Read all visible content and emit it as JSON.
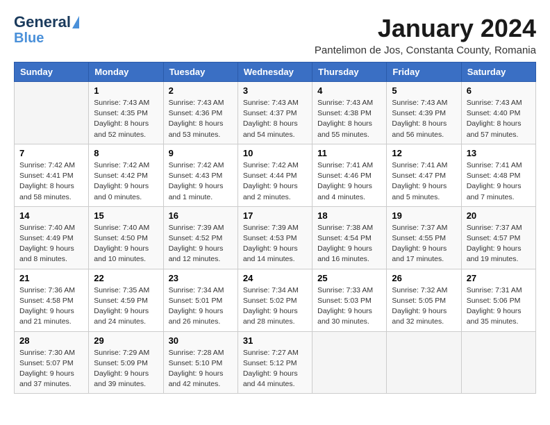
{
  "logo": {
    "line1": "General",
    "line2": "Blue"
  },
  "title": "January 2024",
  "location": "Pantelimon de Jos, Constanta County, Romania",
  "days_of_week": [
    "Sunday",
    "Monday",
    "Tuesday",
    "Wednesday",
    "Thursday",
    "Friday",
    "Saturday"
  ],
  "weeks": [
    [
      {
        "day": "",
        "info": ""
      },
      {
        "day": "1",
        "info": "Sunrise: 7:43 AM\nSunset: 4:35 PM\nDaylight: 8 hours\nand 52 minutes."
      },
      {
        "day": "2",
        "info": "Sunrise: 7:43 AM\nSunset: 4:36 PM\nDaylight: 8 hours\nand 53 minutes."
      },
      {
        "day": "3",
        "info": "Sunrise: 7:43 AM\nSunset: 4:37 PM\nDaylight: 8 hours\nand 54 minutes."
      },
      {
        "day": "4",
        "info": "Sunrise: 7:43 AM\nSunset: 4:38 PM\nDaylight: 8 hours\nand 55 minutes."
      },
      {
        "day": "5",
        "info": "Sunrise: 7:43 AM\nSunset: 4:39 PM\nDaylight: 8 hours\nand 56 minutes."
      },
      {
        "day": "6",
        "info": "Sunrise: 7:43 AM\nSunset: 4:40 PM\nDaylight: 8 hours\nand 57 minutes."
      }
    ],
    [
      {
        "day": "7",
        "info": "Sunrise: 7:42 AM\nSunset: 4:41 PM\nDaylight: 8 hours\nand 58 minutes."
      },
      {
        "day": "8",
        "info": "Sunrise: 7:42 AM\nSunset: 4:42 PM\nDaylight: 9 hours\nand 0 minutes."
      },
      {
        "day": "9",
        "info": "Sunrise: 7:42 AM\nSunset: 4:43 PM\nDaylight: 9 hours\nand 1 minute."
      },
      {
        "day": "10",
        "info": "Sunrise: 7:42 AM\nSunset: 4:44 PM\nDaylight: 9 hours\nand 2 minutes."
      },
      {
        "day": "11",
        "info": "Sunrise: 7:41 AM\nSunset: 4:46 PM\nDaylight: 9 hours\nand 4 minutes."
      },
      {
        "day": "12",
        "info": "Sunrise: 7:41 AM\nSunset: 4:47 PM\nDaylight: 9 hours\nand 5 minutes."
      },
      {
        "day": "13",
        "info": "Sunrise: 7:41 AM\nSunset: 4:48 PM\nDaylight: 9 hours\nand 7 minutes."
      }
    ],
    [
      {
        "day": "14",
        "info": "Sunrise: 7:40 AM\nSunset: 4:49 PM\nDaylight: 9 hours\nand 8 minutes."
      },
      {
        "day": "15",
        "info": "Sunrise: 7:40 AM\nSunset: 4:50 PM\nDaylight: 9 hours\nand 10 minutes."
      },
      {
        "day": "16",
        "info": "Sunrise: 7:39 AM\nSunset: 4:52 PM\nDaylight: 9 hours\nand 12 minutes."
      },
      {
        "day": "17",
        "info": "Sunrise: 7:39 AM\nSunset: 4:53 PM\nDaylight: 9 hours\nand 14 minutes."
      },
      {
        "day": "18",
        "info": "Sunrise: 7:38 AM\nSunset: 4:54 PM\nDaylight: 9 hours\nand 16 minutes."
      },
      {
        "day": "19",
        "info": "Sunrise: 7:37 AM\nSunset: 4:55 PM\nDaylight: 9 hours\nand 17 minutes."
      },
      {
        "day": "20",
        "info": "Sunrise: 7:37 AM\nSunset: 4:57 PM\nDaylight: 9 hours\nand 19 minutes."
      }
    ],
    [
      {
        "day": "21",
        "info": "Sunrise: 7:36 AM\nSunset: 4:58 PM\nDaylight: 9 hours\nand 21 minutes."
      },
      {
        "day": "22",
        "info": "Sunrise: 7:35 AM\nSunset: 4:59 PM\nDaylight: 9 hours\nand 24 minutes."
      },
      {
        "day": "23",
        "info": "Sunrise: 7:34 AM\nSunset: 5:01 PM\nDaylight: 9 hours\nand 26 minutes."
      },
      {
        "day": "24",
        "info": "Sunrise: 7:34 AM\nSunset: 5:02 PM\nDaylight: 9 hours\nand 28 minutes."
      },
      {
        "day": "25",
        "info": "Sunrise: 7:33 AM\nSunset: 5:03 PM\nDaylight: 9 hours\nand 30 minutes."
      },
      {
        "day": "26",
        "info": "Sunrise: 7:32 AM\nSunset: 5:05 PM\nDaylight: 9 hours\nand 32 minutes."
      },
      {
        "day": "27",
        "info": "Sunrise: 7:31 AM\nSunset: 5:06 PM\nDaylight: 9 hours\nand 35 minutes."
      }
    ],
    [
      {
        "day": "28",
        "info": "Sunrise: 7:30 AM\nSunset: 5:07 PM\nDaylight: 9 hours\nand 37 minutes."
      },
      {
        "day": "29",
        "info": "Sunrise: 7:29 AM\nSunset: 5:09 PM\nDaylight: 9 hours\nand 39 minutes."
      },
      {
        "day": "30",
        "info": "Sunrise: 7:28 AM\nSunset: 5:10 PM\nDaylight: 9 hours\nand 42 minutes."
      },
      {
        "day": "31",
        "info": "Sunrise: 7:27 AM\nSunset: 5:12 PM\nDaylight: 9 hours\nand 44 minutes."
      },
      {
        "day": "",
        "info": ""
      },
      {
        "day": "",
        "info": ""
      },
      {
        "day": "",
        "info": ""
      }
    ]
  ]
}
